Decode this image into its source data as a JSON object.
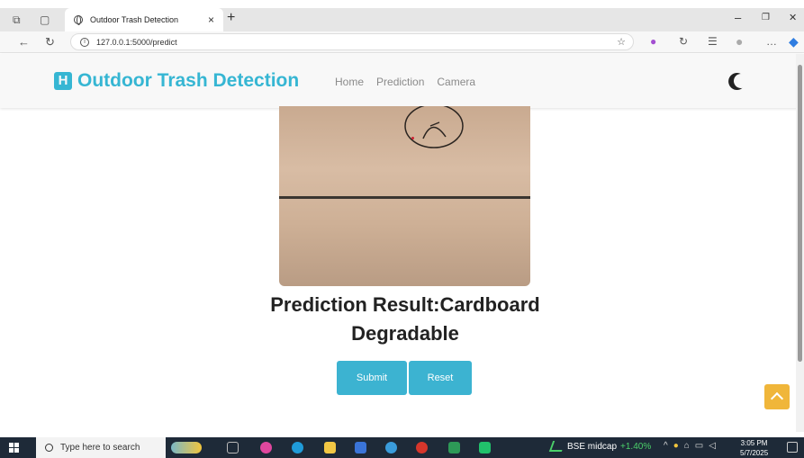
{
  "browser": {
    "tab_title": "Outdoor Trash Detection",
    "tab_close": "×",
    "new_tab": "+",
    "url": "127.0.0.1:5000/predict",
    "minimize": "–",
    "restore": "❐",
    "close": "✕"
  },
  "navbar": {
    "brand": "Outdoor Trash Detection",
    "links": [
      "Home",
      "Prediction",
      "Camera"
    ]
  },
  "result": {
    "line1": "Prediction Result:Cardboard",
    "line2": "Degradable"
  },
  "buttons": {
    "submit": "Submit",
    "reset": "Reset"
  },
  "taskbar": {
    "search_placeholder": "Type here to search",
    "stock_name": "BSE midcap",
    "stock_change": "+1.40%",
    "time": "3:05 PM",
    "date": "5/7/2025"
  },
  "colors": {
    "accent": "#36b6d3",
    "button": "#3cb3d1",
    "to_top": "#f0b63a",
    "taskbar": "#1e2a38"
  }
}
